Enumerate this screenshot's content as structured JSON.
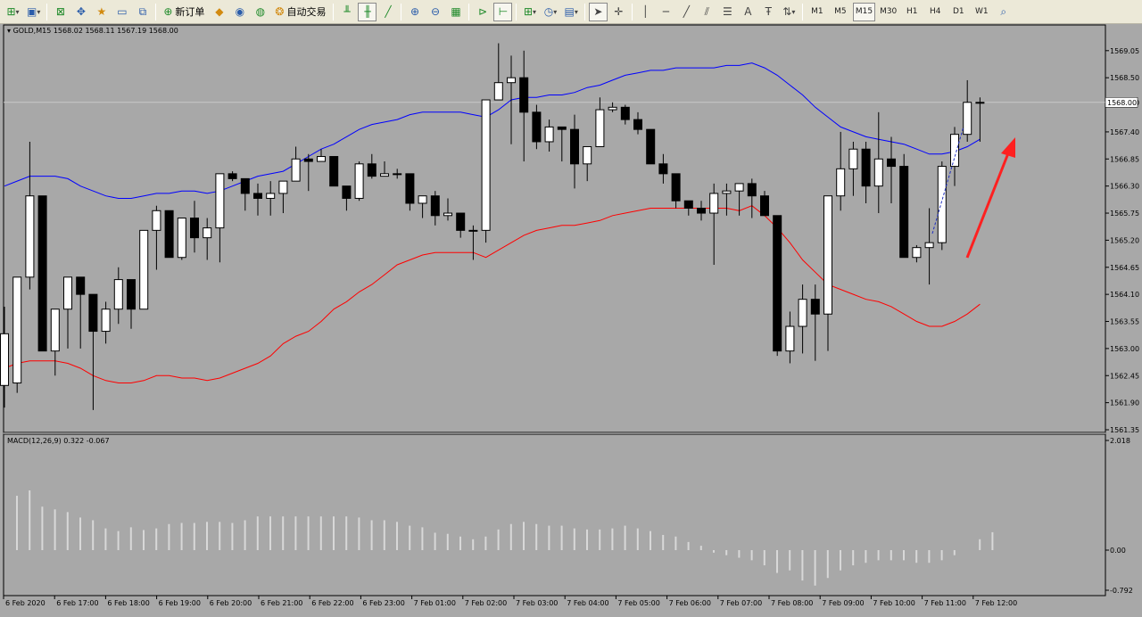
{
  "toolbar": {
    "new_order_label": "新订单",
    "auto_trading_label": "自动交易",
    "timeframes": [
      "M1",
      "M5",
      "M15",
      "M30",
      "H1",
      "H4",
      "D1",
      "W1"
    ],
    "active_timeframe": "M15"
  },
  "chart": {
    "header": "GOLD,M15  1568.02 1568.11 1567.19 1568.00",
    "price_ticks": [
      "1569.05",
      "1568.50",
      "1568.00",
      "1567.40",
      "1566.85",
      "1566.30",
      "1565.75",
      "1565.20",
      "1564.65",
      "1564.10",
      "1563.55",
      "1563.00",
      "1562.45",
      "1561.90",
      "1561.35"
    ],
    "current_price": "1568.00",
    "macd_header": "MACD(12,26,9) 0.322 -0.067",
    "macd_ticks": [
      "2.018",
      "0.00",
      "-0.792"
    ],
    "time_labels": [
      "6 Feb 2020",
      "6 Feb 17:00",
      "6 Feb 18:00",
      "6 Feb 19:00",
      "6 Feb 20:00",
      "6 Feb 21:00",
      "6 Feb 22:00",
      "6 Feb 23:00",
      "7 Feb 01:00",
      "7 Feb 02:00",
      "7 Feb 03:00",
      "7 Feb 04:00",
      "7 Feb 05:00",
      "7 Feb 06:00",
      "7 Feb 07:00",
      "7 Feb 08:00",
      "7 Feb 09:00",
      "7 Feb 10:00",
      "7 Feb 11:00",
      "7 Feb 12:00"
    ],
    "colors": {
      "background": "#a8a8a8",
      "bull": "#ffffff",
      "bear": "#000000",
      "upper_band": "#0000ff",
      "lower_band": "#ff0000",
      "arrow": "#ff2020"
    }
  },
  "chart_data": {
    "type": "candlestick",
    "ohlc": [
      [
        1562.25,
        1563.85,
        1561.8,
        1563.3
      ],
      [
        1562.3,
        1564.45,
        1562.1,
        1564.45
      ],
      [
        1564.45,
        1567.2,
        1564.2,
        1566.1
      ],
      [
        1566.1,
        1566.1,
        1562.95,
        1562.95
      ],
      [
        1562.95,
        1563.8,
        1562.45,
        1563.8
      ],
      [
        1563.8,
        1564.45,
        1563.0,
        1564.45
      ],
      [
        1564.45,
        1564.45,
        1563.0,
        1564.1
      ],
      [
        1564.1,
        1564.1,
        1561.75,
        1563.35
      ],
      [
        1563.35,
        1563.95,
        1563.1,
        1563.8
      ],
      [
        1563.8,
        1564.65,
        1563.5,
        1564.4
      ],
      [
        1564.4,
        1564.4,
        1563.4,
        1563.8
      ],
      [
        1563.8,
        1565.4,
        1563.8,
        1565.4
      ],
      [
        1565.4,
        1565.9,
        1564.6,
        1565.8
      ],
      [
        1565.8,
        1565.8,
        1564.85,
        1564.85
      ],
      [
        1564.85,
        1565.65,
        1564.8,
        1565.65
      ],
      [
        1565.65,
        1566.0,
        1564.95,
        1565.25
      ],
      [
        1565.25,
        1565.65,
        1564.8,
        1565.45
      ],
      [
        1565.45,
        1566.55,
        1564.75,
        1566.55
      ],
      [
        1566.55,
        1566.6,
        1566.4,
        1566.45
      ],
      [
        1566.45,
        1566.45,
        1565.8,
        1566.15
      ],
      [
        1566.15,
        1566.35,
        1565.7,
        1566.05
      ],
      [
        1566.05,
        1566.4,
        1565.7,
        1566.15
      ],
      [
        1566.15,
        1566.4,
        1565.75,
        1566.4
      ],
      [
        1566.4,
        1567.1,
        1566.4,
        1566.85
      ],
      [
        1566.85,
        1566.95,
        1566.2,
        1566.8
      ],
      [
        1566.8,
        1567.05,
        1566.8,
        1566.9
      ],
      [
        1566.9,
        1566.9,
        1566.3,
        1566.3
      ],
      [
        1566.3,
        1566.3,
        1565.8,
        1566.05
      ],
      [
        1566.05,
        1566.8,
        1566.0,
        1566.75
      ],
      [
        1566.75,
        1566.95,
        1566.45,
        1566.5
      ],
      [
        1566.5,
        1566.8,
        1566.5,
        1566.55
      ],
      [
        1566.55,
        1566.65,
        1566.45,
        1566.55
      ],
      [
        1566.55,
        1566.55,
        1565.8,
        1565.95
      ],
      [
        1565.95,
        1566.1,
        1565.65,
        1566.1
      ],
      [
        1566.1,
        1566.2,
        1565.5,
        1565.7
      ],
      [
        1565.7,
        1566.05,
        1565.6,
        1565.75
      ],
      [
        1565.75,
        1565.75,
        1565.25,
        1565.4
      ],
      [
        1565.4,
        1565.5,
        1564.8,
        1565.4
      ],
      [
        1565.4,
        1568.05,
        1565.15,
        1568.05
      ],
      [
        1568.05,
        1569.2,
        1568.05,
        1568.4
      ],
      [
        1568.4,
        1568.95,
        1567.15,
        1568.5
      ],
      [
        1568.5,
        1569.05,
        1566.8,
        1567.8
      ],
      [
        1567.8,
        1567.95,
        1567.05,
        1567.2
      ],
      [
        1567.2,
        1567.65,
        1567.0,
        1567.5
      ],
      [
        1567.5,
        1567.5,
        1566.8,
        1567.45
      ],
      [
        1567.45,
        1567.75,
        1566.25,
        1566.75
      ],
      [
        1566.75,
        1567.1,
        1566.4,
        1567.1
      ],
      [
        1567.1,
        1568.1,
        1567.1,
        1567.85
      ],
      [
        1567.85,
        1568.0,
        1567.8,
        1567.9
      ],
      [
        1567.9,
        1567.95,
        1567.55,
        1567.65
      ],
      [
        1567.65,
        1567.8,
        1567.35,
        1567.45
      ],
      [
        1567.45,
        1567.45,
        1566.95,
        1566.75
      ],
      [
        1566.75,
        1566.95,
        1566.35,
        1566.55
      ],
      [
        1566.55,
        1566.55,
        1565.85,
        1566.0
      ],
      [
        1566.0,
        1566.0,
        1565.7,
        1565.85
      ],
      [
        1565.85,
        1566.0,
        1565.6,
        1565.75
      ],
      [
        1565.75,
        1566.35,
        1564.7,
        1566.15
      ],
      [
        1566.15,
        1566.35,
        1565.7,
        1566.2
      ],
      [
        1566.2,
        1566.35,
        1565.7,
        1566.35
      ],
      [
        1566.35,
        1566.45,
        1565.65,
        1566.1
      ],
      [
        1566.1,
        1566.2,
        1565.75,
        1565.7
      ],
      [
        1565.7,
        1565.7,
        1562.85,
        1562.95
      ],
      [
        1562.95,
        1563.75,
        1562.7,
        1563.45
      ],
      [
        1563.45,
        1564.3,
        1562.9,
        1564.0
      ],
      [
        1564.0,
        1564.3,
        1562.75,
        1563.7
      ],
      [
        1563.7,
        1566.1,
        1562.95,
        1566.1
      ],
      [
        1566.1,
        1567.4,
        1565.8,
        1566.65
      ],
      [
        1566.65,
        1567.2,
        1566.1,
        1567.05
      ],
      [
        1567.05,
        1567.2,
        1565.95,
        1566.3
      ],
      [
        1566.3,
        1567.8,
        1565.75,
        1566.85
      ],
      [
        1566.85,
        1567.3,
        1565.95,
        1566.7
      ],
      [
        1566.7,
        1566.95,
        1564.95,
        1564.85
      ],
      [
        1564.85,
        1565.1,
        1564.75,
        1565.05
      ],
      [
        1565.05,
        1565.85,
        1564.3,
        1565.15
      ],
      [
        1565.15,
        1566.8,
        1565.0,
        1566.7
      ],
      [
        1566.7,
        1567.5,
        1566.3,
        1567.35
      ],
      [
        1567.35,
        1568.45,
        1567.2,
        1568.0
      ],
      [
        1568.0,
        1568.1,
        1567.2,
        1568.0
      ]
    ],
    "bollinger_upper": [
      1566.3,
      1566.4,
      1566.5,
      1566.5,
      1566.5,
      1566.45,
      1566.3,
      1566.2,
      1566.1,
      1566.05,
      1566.05,
      1566.1,
      1566.15,
      1566.15,
      1566.2,
      1566.2,
      1566.15,
      1566.2,
      1566.3,
      1566.4,
      1566.5,
      1566.55,
      1566.6,
      1566.75,
      1566.9,
      1567.05,
      1567.15,
      1567.3,
      1567.45,
      1567.55,
      1567.6,
      1567.65,
      1567.75,
      1567.8,
      1567.8,
      1567.8,
      1567.8,
      1567.75,
      1567.7,
      1567.85,
      1568.05,
      1568.1,
      1568.1,
      1568.15,
      1568.15,
      1568.2,
      1568.3,
      1568.35,
      1568.45,
      1568.55,
      1568.6,
      1568.65,
      1568.65,
      1568.7,
      1568.7,
      1568.7,
      1568.7,
      1568.75,
      1568.75,
      1568.8,
      1568.7,
      1568.55,
      1568.35,
      1568.15,
      1567.9,
      1567.7,
      1567.5,
      1567.4,
      1567.3,
      1567.25,
      1567.2,
      1567.15,
      1567.05,
      1566.95,
      1566.95,
      1567.0,
      1567.1,
      1567.25
    ],
    "bollinger_lower": [
      1562.6,
      1562.7,
      1562.75,
      1562.75,
      1562.75,
      1562.7,
      1562.6,
      1562.45,
      1562.35,
      1562.3,
      1562.3,
      1562.35,
      1562.45,
      1562.45,
      1562.4,
      1562.4,
      1562.35,
      1562.4,
      1562.5,
      1562.6,
      1562.7,
      1562.85,
      1563.1,
      1563.25,
      1563.35,
      1563.55,
      1563.8,
      1563.95,
      1564.15,
      1564.3,
      1564.5,
      1564.7,
      1564.8,
      1564.9,
      1564.95,
      1564.95,
      1564.95,
      1564.95,
      1564.85,
      1565.0,
      1565.15,
      1565.3,
      1565.4,
      1565.45,
      1565.5,
      1565.5,
      1565.55,
      1565.6,
      1565.7,
      1565.75,
      1565.8,
      1565.85,
      1565.85,
      1565.85,
      1565.85,
      1565.85,
      1565.85,
      1565.85,
      1565.8,
      1565.9,
      1565.7,
      1565.45,
      1565.15,
      1564.8,
      1564.55,
      1564.3,
      1564.2,
      1564.1,
      1564.0,
      1563.95,
      1563.85,
      1563.7,
      1563.55,
      1563.45,
      1563.45,
      1563.55,
      1563.7,
      1563.9
    ],
    "macd_histogram": [
      1.0,
      1.1,
      0.8,
      0.75,
      0.7,
      0.6,
      0.55,
      0.4,
      0.35,
      0.42,
      0.37,
      0.4,
      0.48,
      0.5,
      0.5,
      0.52,
      0.52,
      0.5,
      0.55,
      0.62,
      0.62,
      0.62,
      0.62,
      0.62,
      0.62,
      0.62,
      0.62,
      0.6,
      0.55,
      0.55,
      0.52,
      0.45,
      0.42,
      0.32,
      0.3,
      0.25,
      0.2,
      0.25,
      0.38,
      0.48,
      0.52,
      0.48,
      0.45,
      0.45,
      0.4,
      0.38,
      0.38,
      0.4,
      0.45,
      0.4,
      0.35,
      0.28,
      0.25,
      0.15,
      0.08,
      -0.05,
      -0.1,
      -0.15,
      -0.2,
      -0.3,
      -0.45,
      -0.4,
      -0.6,
      -0.7,
      -0.55,
      -0.4,
      -0.3,
      -0.25,
      -0.2,
      -0.2,
      -0.2,
      -0.25,
      -0.25,
      -0.2,
      -0.1,
      0.0,
      0.2,
      0.33
    ],
    "ylim": [
      1561.35,
      1569.3
    ],
    "macd_ylim": [
      -0.792,
      2.018
    ]
  }
}
